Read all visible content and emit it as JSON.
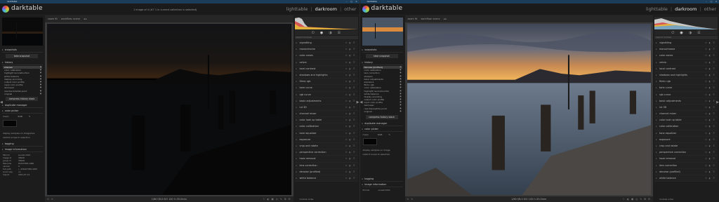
{
  "windows": [
    {
      "title": "darktable",
      "app_name": "darktable",
      "message": "1 image of 4 (#7 1 in current collection is selected)",
      "views": [
        "lighttable",
        "darkroom",
        "other"
      ],
      "active_view": "darkroom",
      "topbar": [
        "zoom fit",
        "workflow: scene",
        "◂  ▸"
      ],
      "left": {
        "snapshots": "snapshots",
        "take_snapshot": "take snapshot",
        "history": "history",
        "history_items": [
          "sharpen",
          "color calibration",
          "highlight reconstruction",
          "white balance",
          "display encoding",
          "output color profile",
          "input color profile",
          "demosaic",
          "raw black/white point",
          "original"
        ],
        "compress": "compress history stack",
        "duplicate": "duplicate manager",
        "color_picker": "color picker",
        "picker_mode": "mean",
        "picker_value": "RGB",
        "display_hint": "display samples on image/live",
        "restrict_hint": "restrict scope to selection",
        "tagging": "tagging",
        "image_info": "image information",
        "info_rows": [
          [
            "filmroll",
            "sunset 2021"
          ],
          [
            "image id",
            "36949"
          ],
          [
            "group id",
            "36949"
          ],
          [
            "filename",
            "DSC07981.ARW"
          ],
          [
            "version",
            "0"
          ],
          [
            "full path",
            "/.../DSC07981.ARW"
          ],
          [
            "local copy",
            "no"
          ],
          [
            "import",
            "2021-07-14"
          ]
        ]
      },
      "bottom_info": "1/60 f/8.0 ISO 100 f=35.0mm",
      "bottom_tools_left": "⊙ ⊙",
      "bottom_tools_right": "⚐ ◐ ▣ ◎ ✎ ⊞ ⊟",
      "right": {
        "search_placeholder": "search module",
        "modules": [
          "vignetting",
          "monochrome",
          "color zones",
          "velvia",
          "local contrast",
          "shadows and highlights",
          "filmic rgb",
          "tone curve",
          "rgb curve",
          "basic adjustments",
          "lut 3D",
          "channel mixer",
          "color look up table",
          "color calibration",
          "tone equalizer",
          "exposure",
          "crop and rotate",
          "perspective correction",
          "haze removal",
          "lens correction",
          "denoise (profiled)",
          "white balance"
        ],
        "module_order": "module order"
      }
    },
    {
      "title": "darktable",
      "app_name": "darktable",
      "message": "",
      "views": [
        "lighttable",
        "darkroom",
        "other"
      ],
      "active_view": "darkroom",
      "topbar": [
        "zoom fit",
        "workflow: scene",
        "◂  ▸"
      ],
      "left": {
        "snapshots": "snapshots",
        "take_snapshot": "take snapshot",
        "history": "history",
        "history_items": [
          "denoise (profiled)",
          "color calibration",
          "lens correction",
          "sharpen",
          "basic adjustments",
          "exposure",
          "filmic rgb",
          "color calibration",
          "highlight reconstruction",
          "white balance",
          "display encoding",
          "output color profile",
          "input color profile",
          "demosaic",
          "raw black/white point",
          "original"
        ],
        "compress": "compress history stack",
        "duplicate": "duplicate manager",
        "color_picker": "color picker",
        "picker_mode": "mean",
        "picker_value": "RGB",
        "display_hint": "display samples on image",
        "restrict_hint": "restrict scope to selection",
        "tagging": "tagging",
        "image_info": "image information",
        "info_rows": [
          [
            "filmroll",
            "sunset 2021"
          ]
        ]
      },
      "bottom_info": "1/60 f/8.0 ISO 100 f=35.0mm",
      "bottom_tools_left": "⊙ ⊙",
      "bottom_tools_right": "⚐ ◐ ▣ ◎ ✎ ⊞ ⊟",
      "right": {
        "search_placeholder": "search module",
        "modules": [
          "vignetting",
          "monochrome",
          "color zones",
          "velvia",
          "local contrast",
          "shadows and highlights",
          "filmic rgb",
          "tone curve",
          "rgb curve",
          "basic adjustments",
          "lut 3D",
          "channel mixer",
          "color look up table",
          "color calibration",
          "tone equalizer",
          "exposure",
          "crop and rotate",
          "perspective correction",
          "haze removal",
          "lens correction",
          "denoise (profiled)",
          "white balance"
        ],
        "module_order": "module order"
      }
    }
  ],
  "colors": {
    "accent": "#1b3d5a",
    "panel": "#1d1d1d",
    "background": "#161616"
  }
}
